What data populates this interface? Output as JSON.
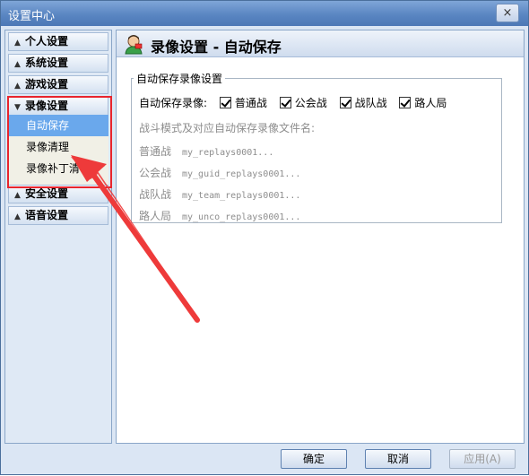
{
  "window": {
    "title": "设置中心",
    "close_glyph": "×"
  },
  "nav": {
    "sections": [
      {
        "label": "个人设置",
        "arrow": "▲"
      },
      {
        "label": "系统设置",
        "arrow": "▲"
      },
      {
        "label": "游戏设置",
        "arrow": "▲"
      },
      {
        "label": "录像设置",
        "arrow": "▼"
      },
      {
        "label": "安全设置",
        "arrow": "▲"
      },
      {
        "label": "语音设置",
        "arrow": "▲"
      }
    ],
    "sub_items": [
      {
        "label": "自动保存",
        "active": true
      },
      {
        "label": "录像清理",
        "active": false
      },
      {
        "label": "录像补丁清",
        "active": false
      }
    ]
  },
  "content": {
    "title": "录像设置 - 自动保存",
    "group_title": "自动保存录像设置",
    "auto_save_label": "自动保存录像:",
    "checkboxes": [
      {
        "label": "普通战",
        "checked": true
      },
      {
        "label": "公会战",
        "checked": true
      },
      {
        "label": "战队战",
        "checked": true
      },
      {
        "label": "路人局",
        "checked": true
      }
    ],
    "mapping_label": "战斗模式及对应自动保存录像文件名:",
    "mappings": [
      {
        "mode": "普通战",
        "file": "my_replays0001..."
      },
      {
        "mode": "公会战",
        "file": "my_guid_replays0001..."
      },
      {
        "mode": "战队战",
        "file": "my_team_replays0001..."
      },
      {
        "mode": "路人局",
        "file": "my_unco_replays0001..."
      }
    ]
  },
  "footer": {
    "ok": "确定",
    "cancel": "取消",
    "apply": "应用(A)"
  },
  "colors": {
    "highlight": "#e8252d",
    "active_item": "#6aa8ec",
    "titlebar": "#5a86c2"
  }
}
